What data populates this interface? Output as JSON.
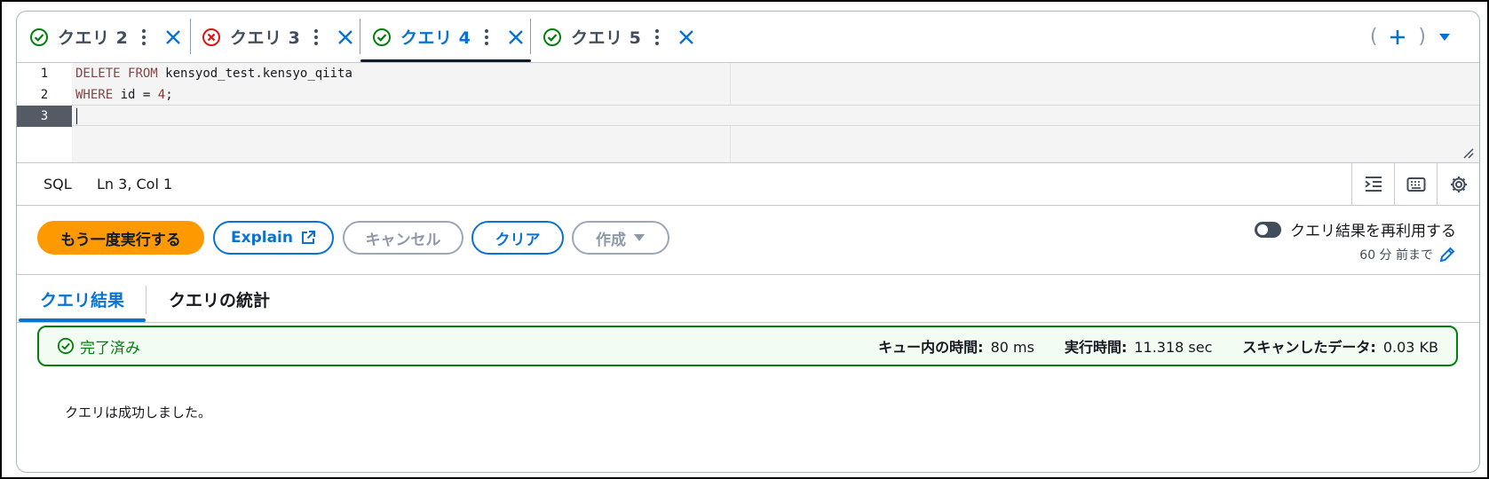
{
  "tabs": [
    {
      "label": "クエリ 2",
      "status": "success",
      "active": false
    },
    {
      "label": "クエリ 3",
      "status": "error",
      "active": false
    },
    {
      "label": "クエリ 4",
      "status": "success",
      "active": true
    },
    {
      "label": "クエリ 5",
      "status": "success",
      "active": false
    }
  ],
  "tab_actions": {
    "open_paren": "(",
    "close_paren": ")"
  },
  "editor": {
    "line_numbers": [
      "1",
      "2",
      "3"
    ],
    "line1": {
      "kw1": "DELETE",
      "kw2": "FROM",
      "rest": "kensyod_test.kensyo_qiita"
    },
    "line2": {
      "kw": "WHERE",
      "mid": "id = ",
      "num": "4",
      "end": ";"
    }
  },
  "statusbar": {
    "language": "SQL",
    "position": "Ln 3, Col 1"
  },
  "buttons": {
    "rerun": "もう一度実行する",
    "explain": "Explain",
    "cancel": "キャンセル",
    "clear": "クリア",
    "create": "作成"
  },
  "reuse": {
    "label": "クエリ結果を再利用する",
    "sub": "60 分 前まで"
  },
  "result_tabs": {
    "results": "クエリ結果",
    "stats": "クエリの統計"
  },
  "result": {
    "status": "完了済み",
    "queue_label": "キュー内の時間:",
    "queue_value": "80 ms",
    "run_label": "実行時間:",
    "run_value": "11.318 sec",
    "scan_label": "スキャンしたデータ:",
    "scan_value": "0.03 KB",
    "message": "クエリは成功しました。"
  },
  "colors": {
    "accent": "#0972d3",
    "primary_button": "#ff9900",
    "success": "#037f0c",
    "error": "#d91515"
  }
}
